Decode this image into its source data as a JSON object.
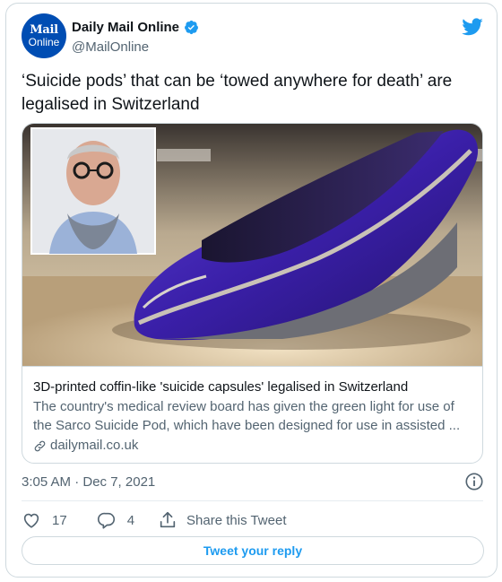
{
  "author": {
    "display_name": "Daily Mail Online",
    "handle": "@MailOnline",
    "avatar_line1": "Mail",
    "avatar_line2": "Online",
    "verified": true
  },
  "tweet": {
    "text": "‘Suicide pods’ that can be ‘towed anywhere for death’ are legalised in Switzerland"
  },
  "link_card": {
    "title": "3D-printed coffin-like 'suicide capsules' legalised in Switzerland",
    "description": "The country's medical review board has given the green light for use of the Sarco Suicide Pod, which have been designed for use in assisted ...",
    "domain": "dailymail.co.uk"
  },
  "meta": {
    "timestamp": "3:05 AM · Dec 7, 2021"
  },
  "actions": {
    "likes": "17",
    "replies": "4",
    "share_label": "Share this Tweet",
    "reply_button_label": "Tweet your reply"
  },
  "colors": {
    "accent": "#1d9bf0",
    "avatar_bg": "#004db3",
    "secondary_text": "#536471",
    "border": "#cfd9de"
  },
  "icons": [
    "twitter-bird-icon",
    "verified-badge-icon",
    "link-icon",
    "info-icon",
    "heart-icon",
    "reply-bubble-icon",
    "share-icon"
  ]
}
